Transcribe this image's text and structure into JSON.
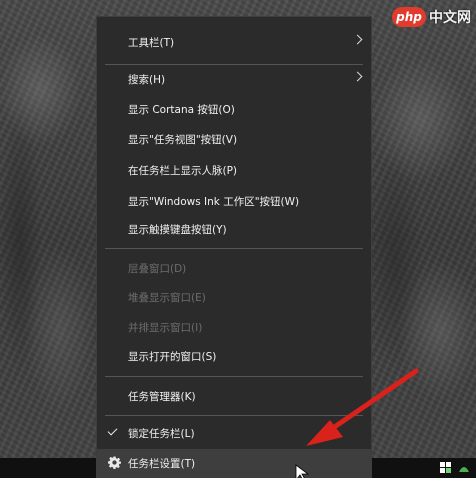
{
  "watermark": {
    "logo": "php",
    "text": "中文网"
  },
  "menu": {
    "toolbars": "工具栏(T)",
    "search": "搜索(H)",
    "cortana": "显示 Cortana 按钮(O)",
    "task_view": "显示\"任务视图\"按钮(V)",
    "people": "在任务栏上显示人脉(P)",
    "ink": "显示\"Windows Ink 工作区\"按钮(W)",
    "touch_keyboard": "显示触摸键盘按钮(Y)",
    "cascade": "层叠窗口(D)",
    "stack": "堆叠显示窗口(E)",
    "side_by_side": "并排显示窗口(I)",
    "show_open": "显示打开的窗口(S)",
    "task_manager": "任务管理器(K)",
    "lock": "锁定任务栏(L)",
    "settings": "任务栏设置(T)"
  },
  "colors": {
    "annotation_arrow": "#d9221b",
    "menu_bg": "#2b2b2b"
  }
}
